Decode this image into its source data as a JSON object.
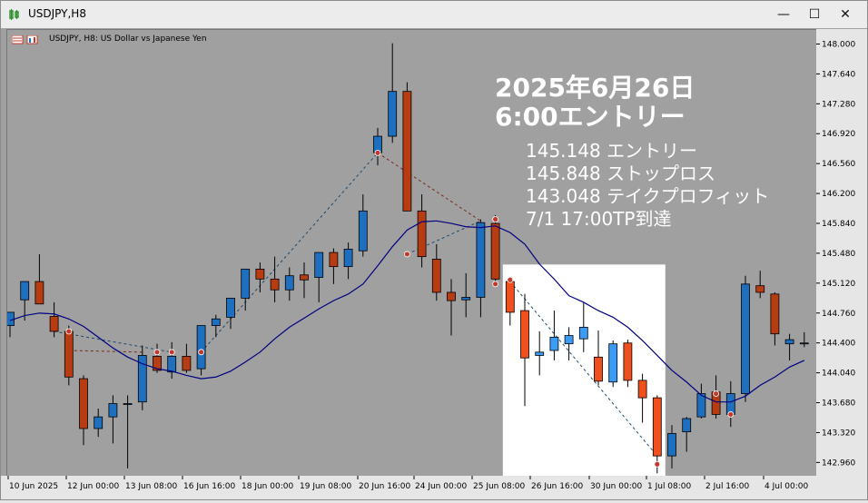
{
  "window": {
    "title": "USDJPY,H8",
    "minimize_glyph": "—",
    "maximize_glyph": "☐",
    "close_glyph": "✕"
  },
  "chart_header": {
    "label": "USDJPY, H8:  US Dollar vs Japanese Yen"
  },
  "annotations": {
    "date_line": "2025年6月26日",
    "entry_line": "6:00エントリー",
    "detail_entry": "145.148 エントリー",
    "detail_stop": "145.848 ストップロス",
    "detail_tp": "143.048 テイクプロフィット",
    "detail_reached": "7/1 17:00TP到達"
  },
  "colors": {
    "chart_bg": "#a0a0a0",
    "bull": "#1f6fbf",
    "bear": "#b83c12",
    "bull_highlight": "#3b9cf5",
    "bear_highlight": "#f0501e",
    "ma_line": "#000080",
    "highlight_box": "#ffffff"
  },
  "chart_data": {
    "type": "candlestick",
    "symbol": "USDJPY",
    "timeframe": "H8",
    "ylim": [
      142.8,
      148.18
    ],
    "y_ticks": [
      "148.000",
      "147.640",
      "147.280",
      "146.920",
      "146.560",
      "146.200",
      "145.840",
      "145.480",
      "145.120",
      "144.760",
      "144.400",
      "144.040",
      "143.680",
      "143.320",
      "142.960"
    ],
    "x_ticks": [
      "10 Jun 2025",
      "12 Jun 00:00",
      "13 Jun 08:00",
      "16 Jun 16:00",
      "18 Jun 00:00",
      "19 Jun 08:00",
      "20 Jun 16:00",
      "24 Jun 00:00",
      "25 Jun 08:00",
      "26 Jun 16:00",
      "30 Jun 00:00",
      "1 Jul 08:00",
      "2 Jul 16:00",
      "4 Jul 00:00"
    ],
    "candles": [
      {
        "o": 144.62,
        "h": 144.78,
        "l": 144.48,
        "c": 144.78
      },
      {
        "o": 144.93,
        "h": 145.12,
        "l": 144.68,
        "c": 145.15
      },
      {
        "o": 145.15,
        "h": 145.48,
        "l": 144.88,
        "c": 144.88
      },
      {
        "o": 144.73,
        "h": 144.9,
        "l": 144.48,
        "c": 144.55
      },
      {
        "o": 144.55,
        "h": 144.62,
        "l": 143.9,
        "c": 144.0
      },
      {
        "o": 143.98,
        "h": 144.02,
        "l": 143.18,
        "c": 143.38
      },
      {
        "o": 143.38,
        "h": 143.62,
        "l": 143.28,
        "c": 143.52
      },
      {
        "o": 143.52,
        "h": 143.78,
        "l": 143.2,
        "c": 143.68
      },
      {
        "o": 143.68,
        "h": 143.78,
        "l": 142.9,
        "c": 143.68
      },
      {
        "o": 143.7,
        "h": 144.38,
        "l": 143.6,
        "c": 144.26
      },
      {
        "o": 144.25,
        "h": 144.4,
        "l": 144.05,
        "c": 144.08
      },
      {
        "o": 144.06,
        "h": 144.42,
        "l": 143.98,
        "c": 144.25
      },
      {
        "o": 144.25,
        "h": 144.4,
        "l": 144.05,
        "c": 144.08
      },
      {
        "o": 144.1,
        "h": 144.6,
        "l": 144.02,
        "c": 144.62
      },
      {
        "o": 144.62,
        "h": 144.75,
        "l": 144.48,
        "c": 144.7
      },
      {
        "o": 144.72,
        "h": 144.9,
        "l": 144.58,
        "c": 144.95
      },
      {
        "o": 144.95,
        "h": 145.22,
        "l": 144.8,
        "c": 145.3
      },
      {
        "o": 145.3,
        "h": 145.38,
        "l": 145.02,
        "c": 145.18
      },
      {
        "o": 145.18,
        "h": 145.45,
        "l": 144.9,
        "c": 145.05
      },
      {
        "o": 145.05,
        "h": 145.32,
        "l": 144.92,
        "c": 145.22
      },
      {
        "o": 145.23,
        "h": 145.38,
        "l": 144.95,
        "c": 145.17
      },
      {
        "o": 145.2,
        "h": 145.48,
        "l": 144.9,
        "c": 145.5
      },
      {
        "o": 145.5,
        "h": 145.55,
        "l": 145.12,
        "c": 145.33
      },
      {
        "o": 145.33,
        "h": 145.62,
        "l": 145.18,
        "c": 145.54
      },
      {
        "o": 145.52,
        "h": 146.2,
        "l": 145.45,
        "c": 146.0
      },
      {
        "o": 146.7,
        "h": 147.0,
        "l": 146.55,
        "c": 146.9
      },
      {
        "o": 146.9,
        "h": 148.02,
        "l": 146.82,
        "c": 147.44
      },
      {
        "o": 147.44,
        "h": 147.55,
        "l": 146.0,
        "c": 146.0
      },
      {
        "o": 146.0,
        "h": 146.2,
        "l": 145.32,
        "c": 145.45
      },
      {
        "o": 145.42,
        "h": 145.6,
        "l": 144.92,
        "c": 145.02
      },
      {
        "o": 145.02,
        "h": 145.18,
        "l": 144.5,
        "c": 144.92
      },
      {
        "o": 144.93,
        "h": 145.25,
        "l": 144.72,
        "c": 144.96
      },
      {
        "o": 144.96,
        "h": 145.9,
        "l": 144.72,
        "c": 145.86
      },
      {
        "o": 145.85,
        "h": 145.95,
        "l": 145.12,
        "c": 145.18
      },
      {
        "o": 145.15,
        "h": 145.16,
        "l": 144.62,
        "c": 144.78
      },
      {
        "o": 144.8,
        "h": 145.0,
        "l": 143.65,
        "c": 144.23
      },
      {
        "o": 144.26,
        "h": 144.55,
        "l": 144.02,
        "c": 144.3
      },
      {
        "o": 144.32,
        "h": 144.8,
        "l": 144.2,
        "c": 144.48
      },
      {
        "o": 144.4,
        "h": 144.6,
        "l": 144.2,
        "c": 144.5
      },
      {
        "o": 144.46,
        "h": 144.9,
        "l": 144.3,
        "c": 144.6
      },
      {
        "o": 144.24,
        "h": 144.56,
        "l": 143.9,
        "c": 143.95
      },
      {
        "o": 143.94,
        "h": 144.44,
        "l": 143.88,
        "c": 144.4
      },
      {
        "o": 144.41,
        "h": 144.45,
        "l": 143.88,
        "c": 143.96
      },
      {
        "o": 143.96,
        "h": 144.04,
        "l": 143.45,
        "c": 143.75
      },
      {
        "o": 143.75,
        "h": 143.78,
        "l": 142.84,
        "c": 143.05
      },
      {
        "o": 143.05,
        "h": 143.42,
        "l": 142.9,
        "c": 143.32
      },
      {
        "o": 143.34,
        "h": 143.52,
        "l": 143.1,
        "c": 143.5
      },
      {
        "o": 143.52,
        "h": 143.92,
        "l": 143.5,
        "c": 143.8
      },
      {
        "o": 143.82,
        "h": 144.02,
        "l": 143.5,
        "c": 143.55
      },
      {
        "o": 143.55,
        "h": 143.95,
        "l": 143.4,
        "c": 143.8
      },
      {
        "o": 143.8,
        "h": 145.22,
        "l": 143.7,
        "c": 145.12
      },
      {
        "o": 145.1,
        "h": 145.28,
        "l": 144.95,
        "c": 145.02
      },
      {
        "o": 145.0,
        "h": 145.02,
        "l": 144.38,
        "c": 144.52
      },
      {
        "o": 144.4,
        "h": 144.52,
        "l": 144.2,
        "c": 144.45
      },
      {
        "o": 144.41,
        "h": 144.54,
        "l": 144.36,
        "c": 144.41
      }
    ],
    "moving_average": [
      144.68,
      144.74,
      144.77,
      144.76,
      144.7,
      144.61,
      144.48,
      144.35,
      144.24,
      144.16,
      144.1,
      144.07,
      144.02,
      143.98,
      144.0,
      144.07,
      144.18,
      144.3,
      144.46,
      144.6,
      144.71,
      144.82,
      144.92,
      145.0,
      145.12,
      145.34,
      145.57,
      145.77,
      145.87,
      145.88,
      145.85,
      145.81,
      145.8,
      145.82,
      145.74,
      145.6,
      145.36,
      145.18,
      144.98,
      144.9,
      144.8,
      144.72,
      144.6,
      144.44,
      144.26,
      144.08,
      143.94,
      143.78,
      143.7,
      143.7,
      143.77,
      143.9,
      144.0,
      144.12,
      144.2
    ]
  }
}
